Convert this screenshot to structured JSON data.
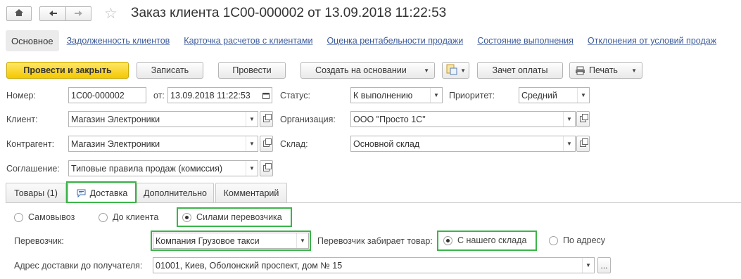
{
  "window": {
    "title": "Заказ клиента 1С00-000002 от 13.09.2018 11:22:53"
  },
  "sections": {
    "main": "Основное",
    "links": [
      "Задолженность клиентов",
      "Карточка расчетов с клиентами",
      "Оценка рентабельности продажи",
      "Состояние выполнения",
      "Отклонения от условий продаж"
    ]
  },
  "toolbar": {
    "post_close": "Провести и закрыть",
    "save": "Записать",
    "post": "Провести",
    "create_based": "Создать на основании",
    "payment_offset": "Зачет оплаты",
    "print": "Печать"
  },
  "form": {
    "number_label": "Номер:",
    "number_value": "1С00-000002",
    "date_label": "от:",
    "date_value": "13.09.2018 11:22:53",
    "status_label": "Статус:",
    "status_value": "К выполнению",
    "priority_label": "Приоритет:",
    "priority_value": "Средний",
    "client_label": "Клиент:",
    "client_value": "Магазин Электроники",
    "org_label": "Организация:",
    "org_value": "ООО \"Просто 1С\"",
    "contractor_label": "Контрагент:",
    "contractor_value": "Магазин Электроники",
    "warehouse_label": "Склад:",
    "warehouse_value": "Основной склад",
    "agreement_label": "Соглашение:",
    "agreement_value": "Типовые правила продаж (комиссия)"
  },
  "tabs": {
    "goods": "Товары (1)",
    "delivery": "Доставка",
    "additional": "Дополнительно",
    "comment": "Комментарий",
    "active": "Доставка"
  },
  "delivery": {
    "options": [
      "Самовывоз",
      "До клиента",
      "Силами перевозчика"
    ],
    "selected_option": "Силами перевозчика",
    "carrier_label": "Перевозчик:",
    "carrier_value": "Компания Грузовое такси",
    "pickup_label": "Перевозчик забирает товар:",
    "pickup_options": [
      "С нашего склада",
      "По адресу"
    ],
    "pickup_selected": "С нашего склада",
    "address_label": "Адрес доставки до получателя:",
    "address_value": "01001, Киев, Оболонский проспект, дом № 15",
    "more_button": "..."
  },
  "colors": {
    "primary_button": "#f4c800",
    "highlight": "#3bb54a",
    "link": "#3b5998"
  }
}
